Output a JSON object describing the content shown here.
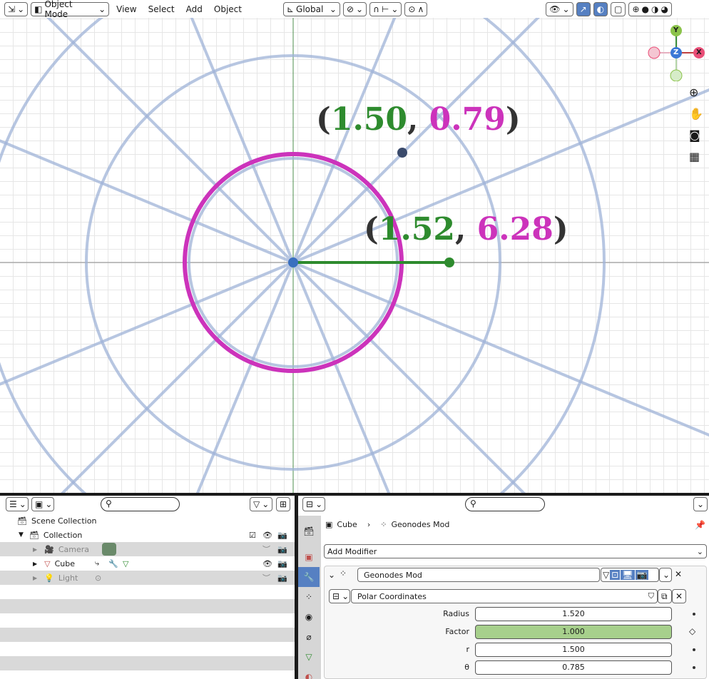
{
  "header": {
    "mode": "Object Mode",
    "menus": [
      "View",
      "Select",
      "Add",
      "Object"
    ],
    "transform_orientation": "Global"
  },
  "viewport": {
    "label_top": {
      "x": "1.50",
      "y": "0.79"
    },
    "label_mid": {
      "x": "1.52",
      "y": "6.28"
    },
    "gizmo": {
      "y": "Y",
      "z": "Z",
      "x": "X"
    },
    "colors": {
      "ring": "#9fb3d8",
      "magenta": "#cc33bb",
      "green": "#2e8b2e",
      "axis_green": "#3b8f3b",
      "axis_red": "#c04040"
    }
  },
  "outliner": {
    "scene_collection": "Scene Collection",
    "collection": "Collection",
    "items": [
      "Camera",
      "Cube",
      "Light"
    ]
  },
  "properties": {
    "breadcrumb_object": "Cube",
    "breadcrumb_modifier": "Geonodes Mod",
    "add_modifier": "Add Modifier",
    "modifier_name": "Geonodes Mod",
    "node_group": "Polar Coordinates",
    "inputs": [
      {
        "label": "Radius",
        "value": "1.520"
      },
      {
        "label": "Factor",
        "value": "1.000"
      },
      {
        "label": "r",
        "value": "1.500"
      },
      {
        "label": "θ",
        "value": "0.785"
      }
    ]
  }
}
